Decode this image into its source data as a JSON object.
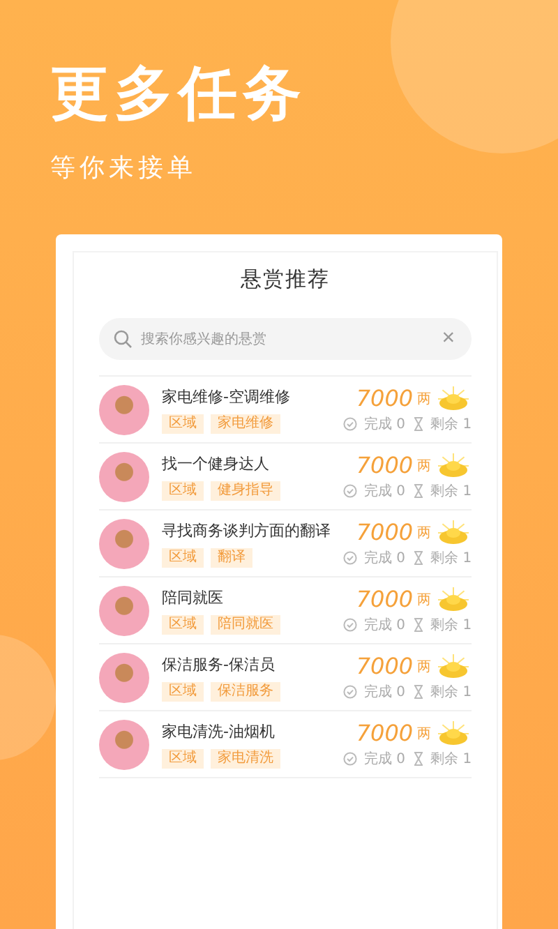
{
  "hero": {
    "title": "更多任务",
    "subtitle": "等你来接单"
  },
  "panel": {
    "title": "悬赏推荐",
    "search": {
      "placeholder": "搜索你感兴趣的悬赏",
      "clear": "×"
    }
  },
  "tasks": [
    {
      "title": "家电维修-空调维修",
      "tags": [
        "区域",
        "家电维修"
      ],
      "reward": "7000",
      "unit": "两",
      "done": "完成 0",
      "remaining": "剩余 1"
    },
    {
      "title": "找一个健身达人",
      "tags": [
        "区域",
        "健身指导"
      ],
      "reward": "7000",
      "unit": "两",
      "done": "完成 0",
      "remaining": "剩余 1"
    },
    {
      "title": "寻找商务谈判方面的翻译",
      "tags": [
        "区域",
        "翻译"
      ],
      "reward": "7000",
      "unit": "两",
      "done": "完成 0",
      "remaining": "剩余 1"
    },
    {
      "title": "陪同就医",
      "tags": [
        "区域",
        "陪同就医"
      ],
      "reward": "7000",
      "unit": "两",
      "done": "完成 0",
      "remaining": "剩余 1"
    },
    {
      "title": "保洁服务-保洁员",
      "tags": [
        "区域",
        "保洁服务"
      ],
      "reward": "7000",
      "unit": "两",
      "done": "完成 0",
      "remaining": "剩余 1"
    },
    {
      "title": "家电清洗-油烟机",
      "tags": [
        "区域",
        "家电清洗"
      ],
      "reward": "7000",
      "unit": "两",
      "done": "完成 0",
      "remaining": "剩余 1"
    }
  ]
}
